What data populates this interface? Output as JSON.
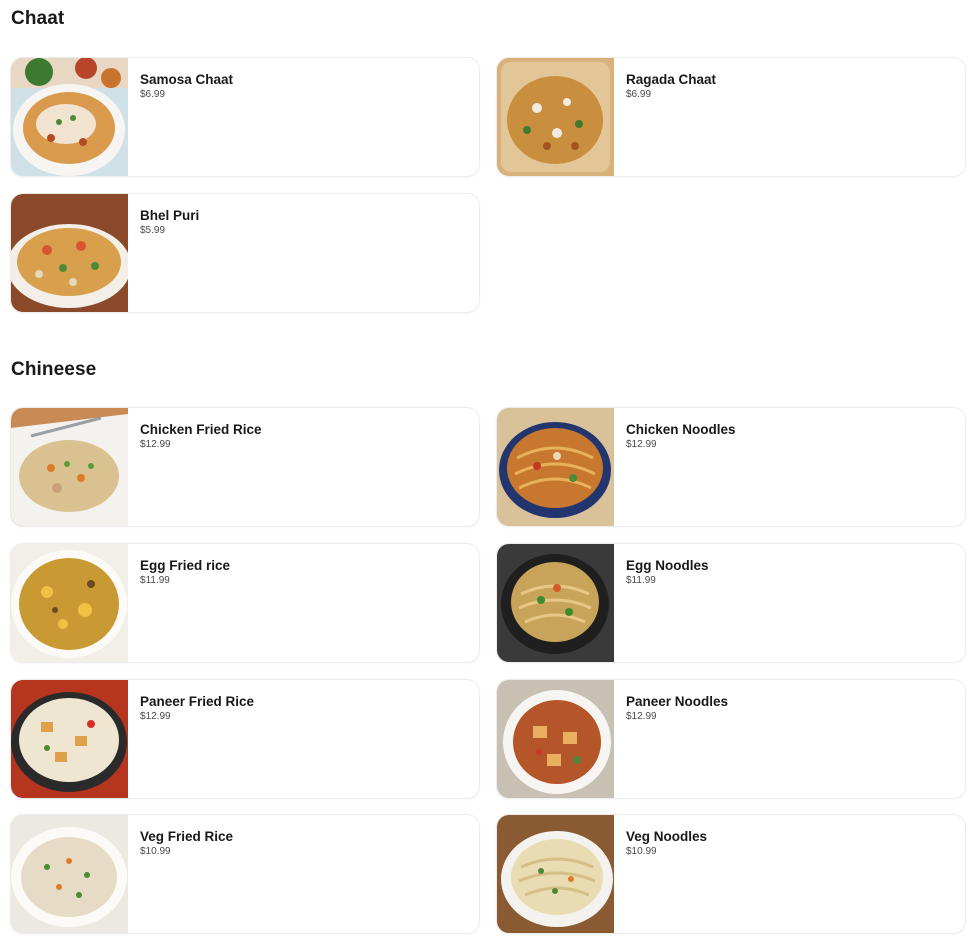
{
  "sections": [
    {
      "title": "Chaat",
      "items": [
        {
          "name": "Samosa Chaat",
          "price": "$6.99"
        },
        {
          "name": "Ragada Chaat",
          "price": "$6.99"
        },
        {
          "name": "Bhel Puri",
          "price": "$5.99"
        }
      ]
    },
    {
      "title": "Chineese",
      "items": [
        {
          "name": "Chicken Fried Rice",
          "price": "$12.99"
        },
        {
          "name": "Chicken Noodles",
          "price": "$12.99"
        },
        {
          "name": "Egg Fried rice",
          "price": "$11.99"
        },
        {
          "name": "Egg Noodles",
          "price": "$11.99"
        },
        {
          "name": "Paneer Fried Rice",
          "price": "$12.99"
        },
        {
          "name": "Paneer Noodles",
          "price": "$12.99"
        },
        {
          "name": "Veg Fried Rice",
          "price": "$10.99"
        },
        {
          "name": "Veg Noodles",
          "price": "$10.99"
        }
      ]
    }
  ]
}
